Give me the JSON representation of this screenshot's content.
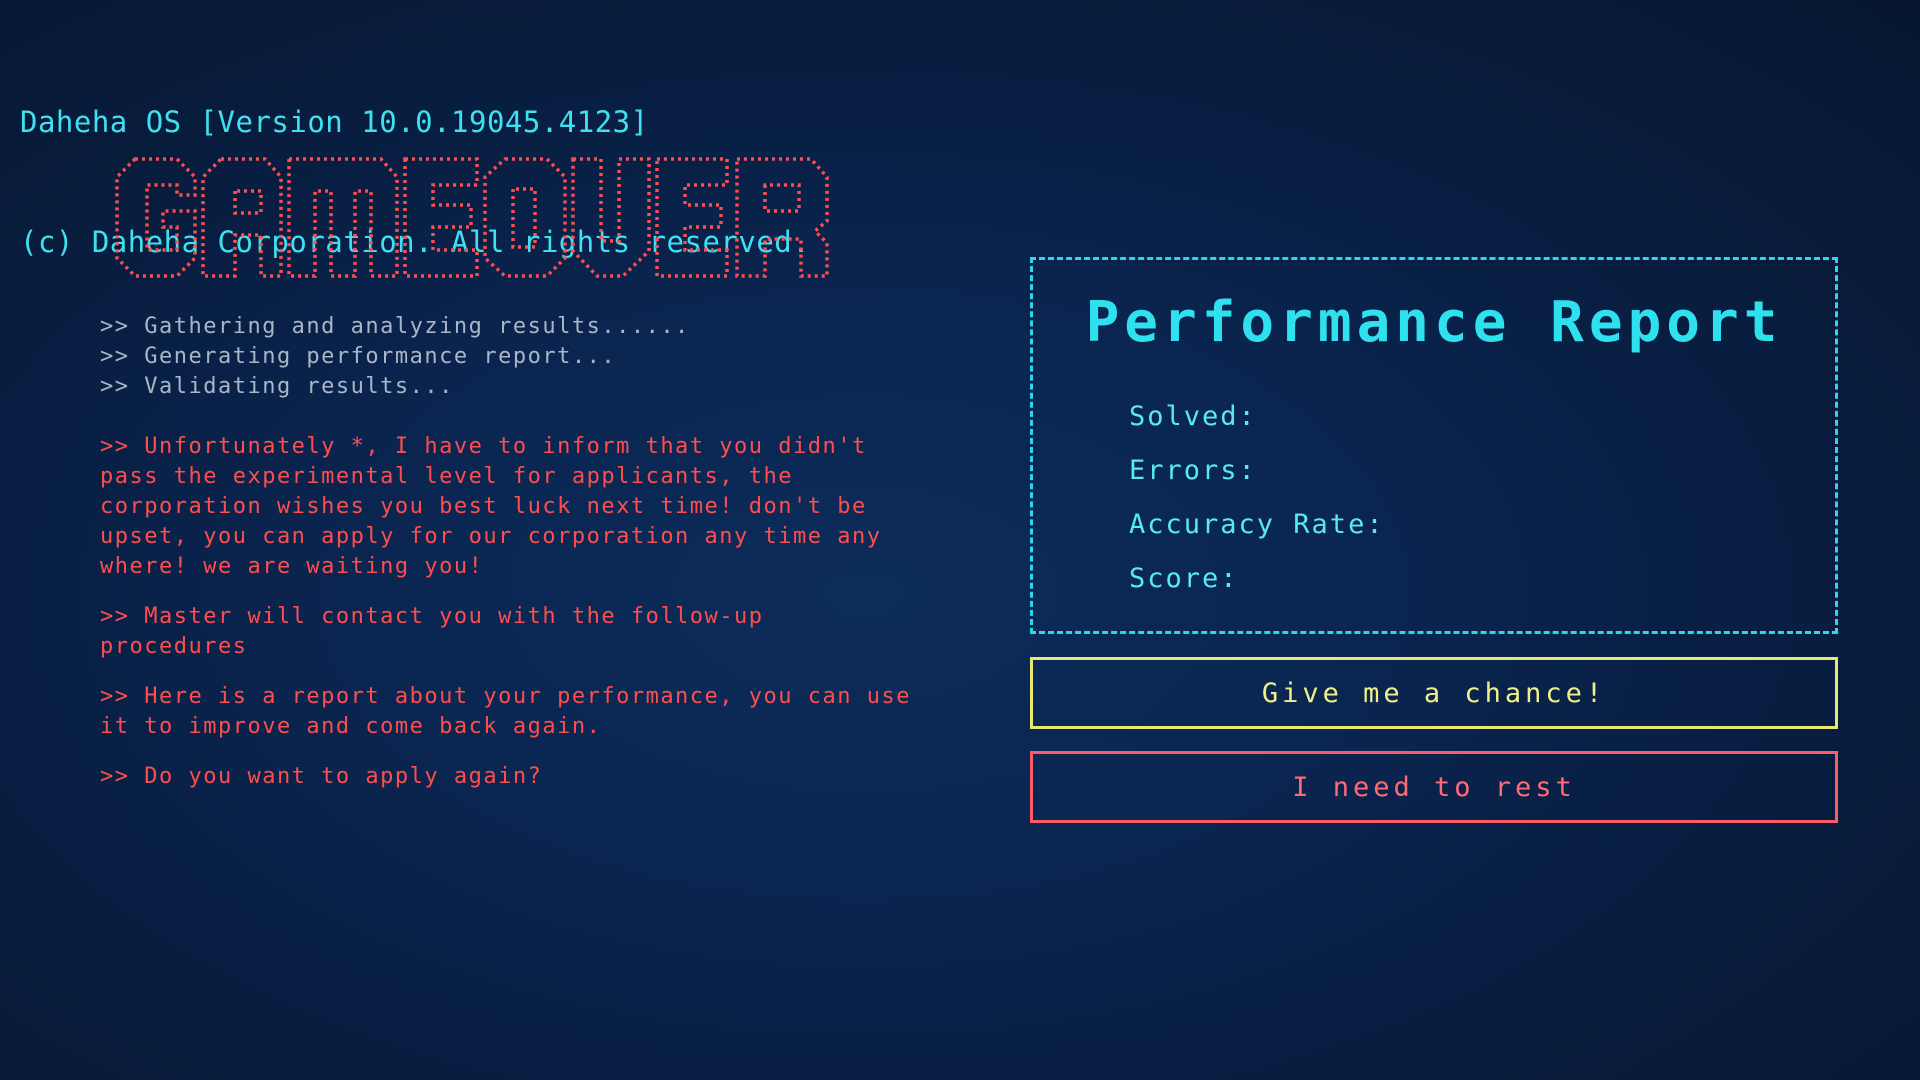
{
  "header": {
    "line1": "Daheha OS [Version 10.0.19045.4123]",
    "line2": "(c) Daheha Corporation. All rights reserved."
  },
  "banner": {
    "text": "GAMEOVER",
    "color": "#ff4d4d"
  },
  "log": {
    "lines": [
      ">> Gathering and analyzing results......",
      ">> Generating performance report...",
      ">> Validating results..."
    ],
    "messages": [
      ">> Unfortunately *, I have to inform that you didn't pass the experimental level for applicants, the corporation wishes you best luck next time! don't be upset, you can apply for our corporation any time any where! we are waiting you!",
      ">> Master will contact you with the follow-up procedures",
      ">> Here is a report about your performance, you can use it to improve and come back again.",
      ">> Do you want to apply again?"
    ]
  },
  "report": {
    "title": "Performance Report",
    "stats": [
      "Solved:",
      "Errors:",
      "Accuracy Rate:",
      "Score:"
    ]
  },
  "buttons": {
    "chance": "Give me a chance!",
    "rest": "I need to rest"
  },
  "colors": {
    "background": "#0a2550",
    "accent_cyan": "#2fd6e6",
    "danger_red": "#ff4d4d",
    "muted_gray": "#a9b6c7",
    "button_yellow": "#e6e870",
    "button_red": "#ff5a66"
  }
}
